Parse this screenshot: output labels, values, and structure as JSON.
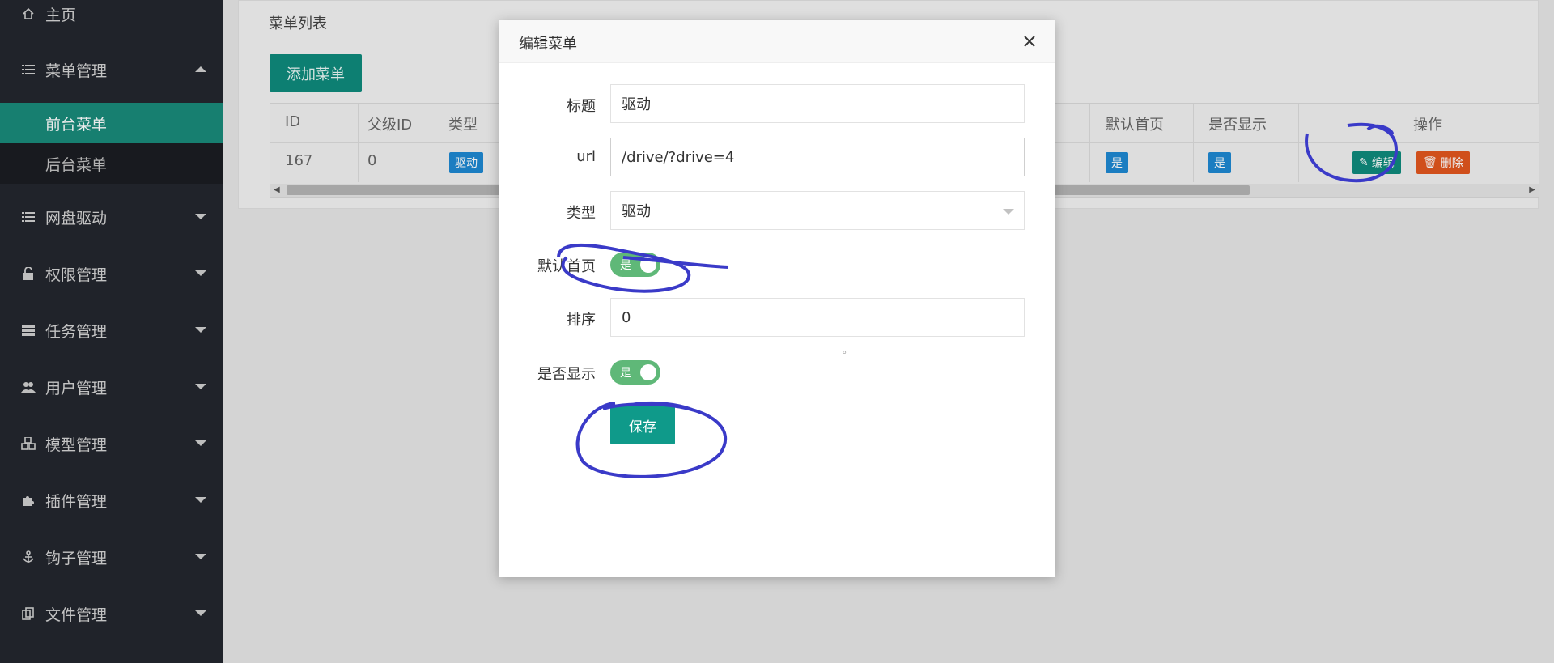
{
  "sidebar": {
    "items": [
      {
        "label": "主页"
      },
      {
        "label": "菜单管理"
      },
      {
        "label": "前台菜单"
      },
      {
        "label": "后台菜单"
      },
      {
        "label": "网盘驱动"
      },
      {
        "label": "权限管理"
      },
      {
        "label": "任务管理"
      },
      {
        "label": "用户管理"
      },
      {
        "label": "模型管理"
      },
      {
        "label": "插件管理"
      },
      {
        "label": "钩子管理"
      },
      {
        "label": "文件管理"
      }
    ]
  },
  "main": {
    "card_title": "菜单列表",
    "add_button": "添加菜单",
    "table": {
      "headers": {
        "id": "ID",
        "parent_id": "父级ID",
        "type": "类型",
        "default_home": "默认首页",
        "is_show": "是否显示",
        "actions": "操作"
      },
      "row": {
        "id": "167",
        "parent_id": "0",
        "type": "驱动",
        "default_home": "是",
        "is_show": "是",
        "edit": "编辑",
        "delete": "删除"
      }
    }
  },
  "modal": {
    "title": "编辑菜单",
    "fields": {
      "title_label": "标题",
      "title_value": "驱动",
      "url_label": "url",
      "url_value": "/drive/?drive=4",
      "type_label": "类型",
      "type_value": "驱动",
      "default_home_label": "默认首页",
      "default_home_switch": "是",
      "sort_label": "排序",
      "sort_value": "0",
      "sort_hint": "。",
      "is_show_label": "是否显示",
      "is_show_switch": "是"
    },
    "save_button": "保存"
  },
  "colors": {
    "sidebar_bg": "#23262e",
    "active_item": "#1a8a7a",
    "primary": "#0f9a8a",
    "switch_on": "#5fb878",
    "badge_blue": "#1e88d2",
    "danger": "#e2561e",
    "annotation": "#3a3ac8"
  }
}
